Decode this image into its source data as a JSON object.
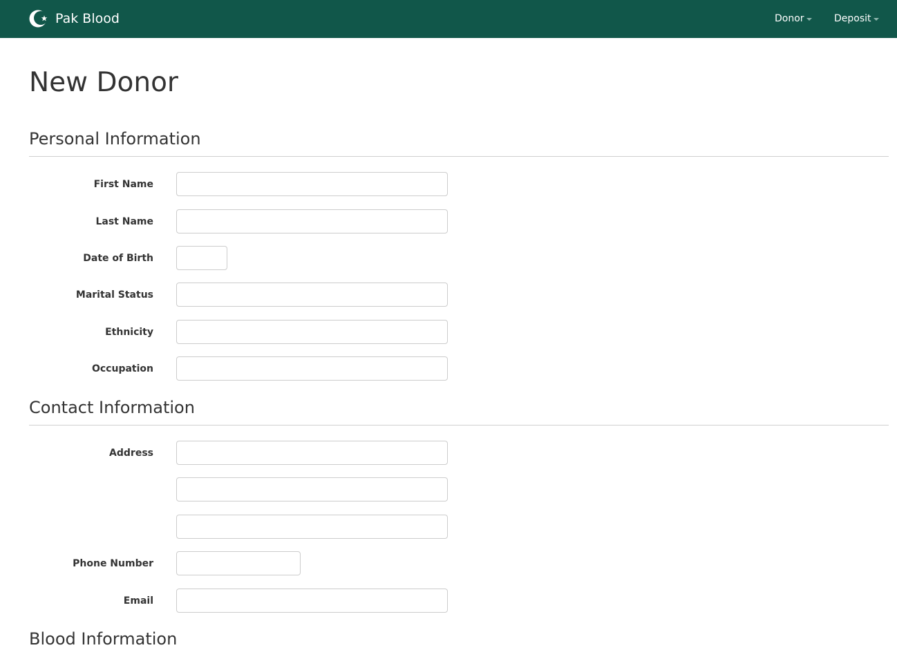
{
  "navbar": {
    "brand": "Pak Blood",
    "brand_icon": "crescent-star-icon",
    "menus": [
      {
        "label": "Donor"
      },
      {
        "label": "Deposit"
      }
    ],
    "color": "#11574a"
  },
  "page": {
    "title": "New Donor"
  },
  "sections": {
    "personal": {
      "heading": "Personal Information",
      "fields": {
        "first_name": {
          "label": "First Name",
          "value": ""
        },
        "last_name": {
          "label": "Last Name",
          "value": ""
        },
        "date_of_birth": {
          "label": "Date of Birth",
          "value": ""
        },
        "marital_status": {
          "label": "Marital Status",
          "value": ""
        },
        "ethnicity": {
          "label": "Ethnicity",
          "value": ""
        },
        "occupation": {
          "label": "Occupation",
          "value": ""
        }
      }
    },
    "contact": {
      "heading": "Contact Information",
      "fields": {
        "address": {
          "label": "Address",
          "line1": "",
          "line2": "",
          "line3": ""
        },
        "phone": {
          "label": "Phone Number",
          "value": ""
        },
        "email": {
          "label": "Email",
          "value": ""
        }
      }
    },
    "blood": {
      "heading": "Blood Information"
    }
  }
}
